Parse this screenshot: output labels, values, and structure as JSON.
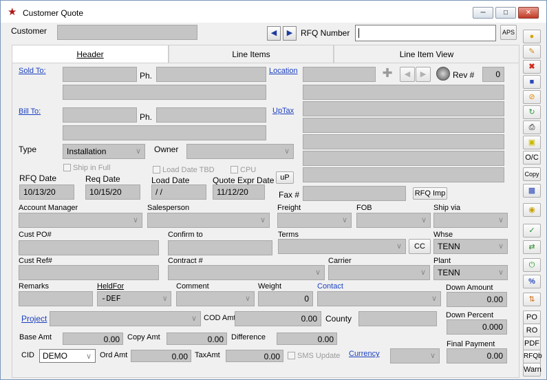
{
  "window": {
    "title": "Customer Quote",
    "minimize_icon": "minimize-icon",
    "maximize_icon": "maximize-icon",
    "close_icon": "close-icon"
  },
  "header": {
    "customer_label": "Customer",
    "rfq_number_label": "RFQ Number",
    "rfq_number_value": "",
    "aps_label": "APS"
  },
  "tabs": [
    {
      "label": "Header",
      "active": true
    },
    {
      "label": "Line Items",
      "active": false
    },
    {
      "label": "Line Item View",
      "active": false
    }
  ],
  "form": {
    "sold_to_label": "Sold To:",
    "ph_label": "Ph.",
    "location_label": "Location",
    "rev_label": "Rev #",
    "rev_value": "0",
    "bill_to_label": "Bill To:",
    "uptax_label": "UpTax",
    "type_label": "Type",
    "type_value": "Installation",
    "owner_label": "Owner",
    "owner_value": "",
    "ship_in_full_label": "Ship in Full",
    "load_date_tbd_label": "Load Date TBD",
    "cpu_label": "CPU",
    "rfq_date_label": "RFQ Date",
    "rfq_date_value": "10/13/20",
    "req_date_label": "Req Date",
    "req_date_value": "10/15/20",
    "load_date_label": "Load Date",
    "load_date_value": "/ /",
    "quote_expr_label": "Quote Expr Date",
    "quote_expr_value": "11/12/20",
    "up_label": "uP",
    "fax_label": "Fax #",
    "rfq_imp_label": "RFQ Imp",
    "account_manager_label": "Account Manager",
    "salesperson_label": "Salesperson",
    "freight_label": "Freight",
    "fob_label": "FOB",
    "ship_via_label": "Ship via",
    "cust_po_label": "Cust PO#",
    "confirm_to_label": "Confirm to",
    "terms_label": "Terms",
    "cc_label": "CC",
    "whse_label": "Whse",
    "whse_value": "TENN",
    "cust_ref_label": "Cust Ref#",
    "contract_label": "Contract #",
    "carrier_label": "Carrier",
    "plant_label": "Plant",
    "plant_value": "TENN",
    "remarks_label": "Remarks",
    "heldfor_label": "HeldFor",
    "heldfor_value": "-DEF",
    "comment_label": "Comment",
    "weight_label": "Weight",
    "weight_value": "0",
    "contact_label": "Contact",
    "down_amount_label": "Down Amount",
    "down_amount_value": "0.00",
    "project_label": "Project",
    "cod_amt_label": "COD Amt",
    "cod_amt_value": "0.00",
    "county_label": "County",
    "down_percent_label": "Down Percent",
    "down_percent_value": "0.000",
    "base_amt_label": "Base Amt",
    "base_amt_value": "0.00",
    "copy_amt_label": "Copy Amt",
    "copy_amt_value": "0.00",
    "difference_label": "Difference",
    "difference_value": "0.00",
    "final_payment_label": "Final Payment",
    "final_payment_value": "0.00",
    "cid_label": "CID",
    "cid_value": "DEMO",
    "ord_amt_label": "Ord Amt",
    "ord_amt_value": "0.00",
    "tax_amt_label": "TaxAmt",
    "tax_amt_value": "0.00",
    "sms_update_label": "SMS Update",
    "currency_label": "Currency"
  },
  "sidebar": {
    "oc_label": "O/C",
    "copy_label": "Copy",
    "po_label": "PO",
    "ro_label": "RO",
    "pdf_label": "PDF",
    "rfqb_label": "RFQb",
    "warn_label": "Warn"
  }
}
